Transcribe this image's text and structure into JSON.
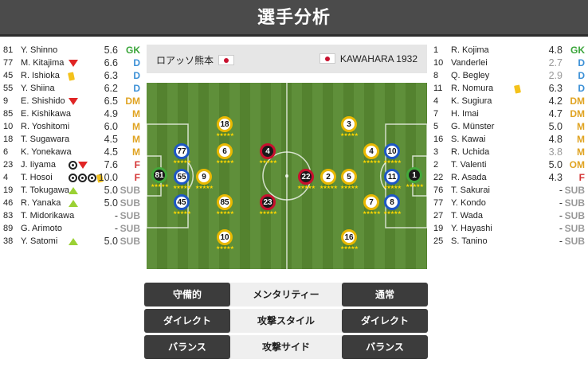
{
  "title": "選手分析",
  "match": {
    "home_team": "ロアッソ熊本",
    "away_team": "KAWAHARA 1932"
  },
  "home_roster": [
    {
      "num": "81",
      "name": "Y. Shinno",
      "rating": "5.6",
      "pos": "GK",
      "icons": []
    },
    {
      "num": "77",
      "name": "M. Kitajima",
      "rating": "6.6",
      "pos": "D",
      "icons": [
        "sub-off"
      ]
    },
    {
      "num": "45",
      "name": "R. Ishioka",
      "rating": "6.3",
      "pos": "D",
      "icons": [
        "yellow-card"
      ]
    },
    {
      "num": "55",
      "name": "Y. Shiina",
      "rating": "6.2",
      "pos": "D",
      "icons": []
    },
    {
      "num": "9",
      "name": "E. Shishido",
      "rating": "6.5",
      "pos": "DM",
      "icons": [
        "sub-off"
      ]
    },
    {
      "num": "85",
      "name": "E. Kishikawa",
      "rating": "4.9",
      "pos": "M",
      "icons": []
    },
    {
      "num": "10",
      "name": "R. Yoshitomi",
      "rating": "6.0",
      "pos": "M",
      "icons": []
    },
    {
      "num": "18",
      "name": "T. Sugawara",
      "rating": "4.5",
      "pos": "M",
      "icons": []
    },
    {
      "num": "6",
      "name": "K. Yonekawa",
      "rating": "4.5",
      "pos": "M",
      "icons": []
    },
    {
      "num": "23",
      "name": "J. Iiyama",
      "rating": "7.6",
      "pos": "F",
      "icons": [
        "goal",
        "sub-off"
      ]
    },
    {
      "num": "4",
      "name": "T. Hosoi",
      "rating": "10.0",
      "pos": "F",
      "icons": [
        "goal",
        "goal",
        "goal",
        "yellow-card"
      ]
    },
    {
      "num": "19",
      "name": "T. Tokugawa",
      "rating": "5.0",
      "pos": "SUB",
      "icons": [
        "sub-on"
      ]
    },
    {
      "num": "46",
      "name": "R. Yanaka",
      "rating": "5.0",
      "pos": "SUB",
      "icons": [
        "sub-on"
      ]
    },
    {
      "num": "83",
      "name": "T. Midorikawa",
      "rating": "-",
      "pos": "SUB",
      "icons": []
    },
    {
      "num": "89",
      "name": "G. Arimoto",
      "rating": "-",
      "pos": "SUB",
      "icons": []
    },
    {
      "num": "38",
      "name": "Y. Satomi",
      "rating": "5.0",
      "pos": "SUB",
      "icons": [
        "sub-on"
      ]
    }
  ],
  "away_roster": [
    {
      "num": "1",
      "name": "R. Kojima",
      "rating": "4.8",
      "pos": "GK",
      "icons": [],
      "grey": false
    },
    {
      "num": "10",
      "name": "Vanderlei",
      "rating": "2.7",
      "pos": "D",
      "icons": [],
      "grey": true
    },
    {
      "num": "8",
      "name": "Q. Begley",
      "rating": "2.9",
      "pos": "D",
      "icons": [],
      "grey": true
    },
    {
      "num": "11",
      "name": "R. Nomura",
      "rating": "6.3",
      "pos": "D",
      "icons": [
        "yellow-card"
      ],
      "grey": false
    },
    {
      "num": "4",
      "name": "K. Sugiura",
      "rating": "4.2",
      "pos": "DM",
      "icons": [],
      "grey": false
    },
    {
      "num": "7",
      "name": "H. Imai",
      "rating": "4.7",
      "pos": "DM",
      "icons": [],
      "grey": false
    },
    {
      "num": "5",
      "name": "G. Münster",
      "rating": "5.0",
      "pos": "M",
      "icons": [],
      "grey": false
    },
    {
      "num": "16",
      "name": "S. Kawai",
      "rating": "4.8",
      "pos": "M",
      "icons": [],
      "grey": false
    },
    {
      "num": "3",
      "name": "R. Uchida",
      "rating": "3.8",
      "pos": "M",
      "icons": [],
      "grey": true
    },
    {
      "num": "2",
      "name": "T. Valenti",
      "rating": "5.0",
      "pos": "OM",
      "icons": [],
      "grey": false
    },
    {
      "num": "22",
      "name": "R. Asada",
      "rating": "4.3",
      "pos": "F",
      "icons": [],
      "grey": false
    },
    {
      "num": "76",
      "name": "T. Sakurai",
      "rating": "-",
      "pos": "SUB",
      "icons": [],
      "grey": false
    },
    {
      "num": "77",
      "name": "Y. Kondo",
      "rating": "-",
      "pos": "SUB",
      "icons": [],
      "grey": false
    },
    {
      "num": "27",
      "name": "T. Wada",
      "rating": "-",
      "pos": "SUB",
      "icons": [],
      "grey": false
    },
    {
      "num": "19",
      "name": "Y. Hayashi",
      "rating": "-",
      "pos": "SUB",
      "icons": [],
      "grey": false
    },
    {
      "num": "25",
      "name": "S. Tanino",
      "rating": "-",
      "pos": "SUB",
      "icons": [],
      "grey": false
    }
  ],
  "stars": "★★★★★",
  "formation_home": [
    {
      "num": "81",
      "style": "gr"
    },
    {
      "num": "77",
      "style": "bl"
    },
    {
      "num": "55",
      "style": "bl"
    },
    {
      "num": "45",
      "style": "bl"
    },
    {
      "num": "6",
      "style": "yl"
    },
    {
      "num": "9",
      "style": "yl"
    },
    {
      "num": "85",
      "style": "yl"
    },
    {
      "num": "18",
      "style": "yl"
    },
    {
      "num": "10",
      "style": "yl"
    },
    {
      "num": "4",
      "style": "rd"
    },
    {
      "num": "23",
      "style": "rd"
    }
  ],
  "formation_away": [
    {
      "num": "1",
      "style": "gr"
    },
    {
      "num": "10",
      "style": "bl"
    },
    {
      "num": "11",
      "style": "bl"
    },
    {
      "num": "8",
      "style": "bl"
    },
    {
      "num": "4",
      "style": "yl"
    },
    {
      "num": "7",
      "style": "yl"
    },
    {
      "num": "5",
      "style": "yl"
    },
    {
      "num": "2",
      "style": "yl"
    },
    {
      "num": "3",
      "style": "yl"
    },
    {
      "num": "16",
      "style": "yl"
    },
    {
      "num": "22",
      "style": "rd"
    }
  ],
  "tactics": [
    {
      "home": "守備的",
      "label": "メンタリティー",
      "away": "通常"
    },
    {
      "home": "ダイレクト",
      "label": "攻撃スタイル",
      "away": "ダイレクト"
    },
    {
      "home": "バランス",
      "label": "攻撃サイド",
      "away": "バランス"
    }
  ]
}
